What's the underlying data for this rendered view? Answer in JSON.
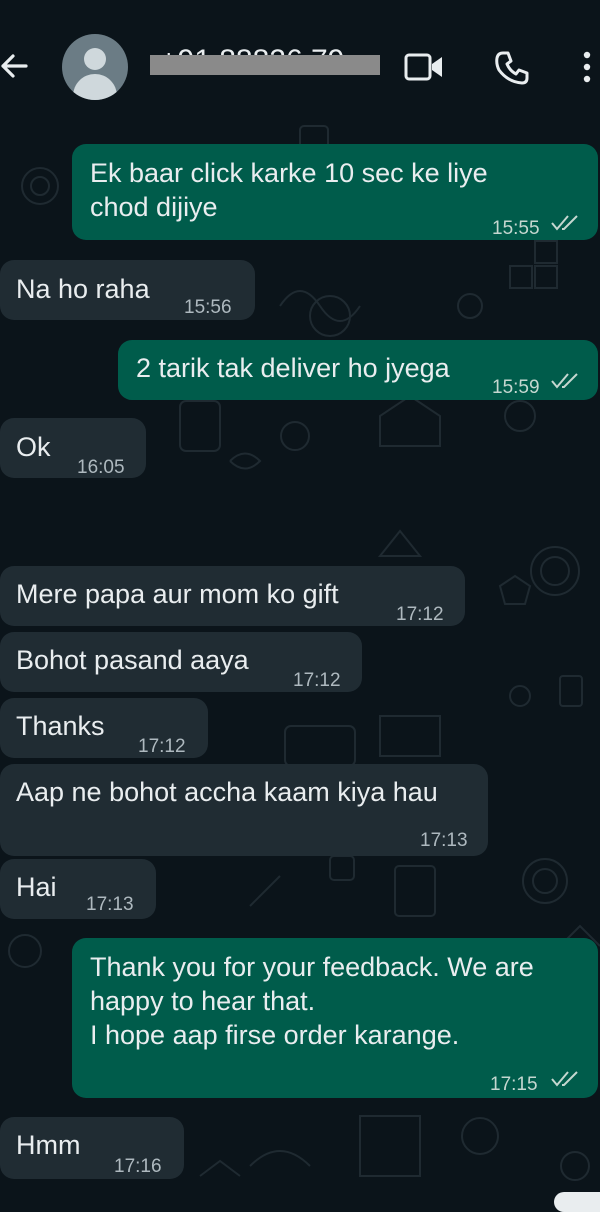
{
  "colors": {
    "background": "#0b141a",
    "incoming_bubble": "#202c33",
    "outgoing_bubble": "#005c4b",
    "text": "#e9edef",
    "timestamp": "#aeb9bf",
    "read_ticks": "#c5d7d0"
  },
  "header": {
    "contact_name": "+91 88826 79...",
    "icons": [
      "back-arrow-icon",
      "avatar",
      "video-call-icon",
      "voice-call-icon",
      "more-options-icon"
    ]
  },
  "messages": [
    {
      "direction": "out",
      "text": "Ek baar click karke 10 sec ke liye\nchod dijiye",
      "time": "15:55",
      "status": "read"
    },
    {
      "direction": "in",
      "text": "Na ho raha",
      "time": "15:56"
    },
    {
      "direction": "out",
      "text": "2 tarik tak deliver ho jyega",
      "time": "15:59",
      "status": "read"
    },
    {
      "direction": "in",
      "text": "Ok",
      "time": "16:05"
    },
    {
      "direction": "in",
      "text": "Mere papa aur mom ko gift",
      "time": "17:12"
    },
    {
      "direction": "in",
      "text": "Bohot pasand aaya",
      "time": "17:12"
    },
    {
      "direction": "in",
      "text": "Thanks",
      "time": "17:12"
    },
    {
      "direction": "in",
      "text": "Aap ne bohot accha kaam kiya hau",
      "time": "17:13"
    },
    {
      "direction": "in",
      "text": "Hai",
      "time": "17:13"
    },
    {
      "direction": "out",
      "text": "Thank you for your feedback. We are\nhappy to hear that.\nI hope aap firse order karange.",
      "time": "17:15",
      "status": "read"
    },
    {
      "direction": "in",
      "text": "Hmm",
      "time": "17:16"
    }
  ]
}
